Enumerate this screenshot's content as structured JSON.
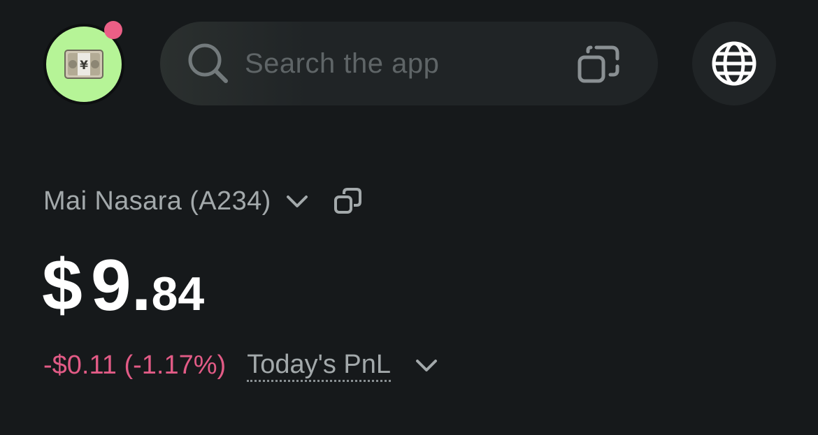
{
  "header": {
    "avatar_emoji": "💴",
    "has_notification": true,
    "notification_color": "#ea5f86",
    "avatar_bg_color": "#b6f497"
  },
  "search": {
    "placeholder": "Search the app",
    "left_icon": "search-icon",
    "right_icon": "scan-icon"
  },
  "globe": {
    "icon": "globe-icon"
  },
  "account": {
    "name": "Mai Nasara (A234)",
    "dropdown_icon": "chevron-down-icon",
    "copy_icon": "copy-icon"
  },
  "balance": {
    "currency": "$",
    "integer": "9",
    "dot": ".",
    "decimal": "84"
  },
  "pnl": {
    "value": "-$0.11 (-1.17%)",
    "label": "Today's PnL",
    "dropdown_icon": "chevron-down-icon",
    "negative_color": "#e25b86"
  },
  "colors": {
    "background": "#16191b",
    "surface": "#202426",
    "muted_text": "#a3a9ab"
  }
}
